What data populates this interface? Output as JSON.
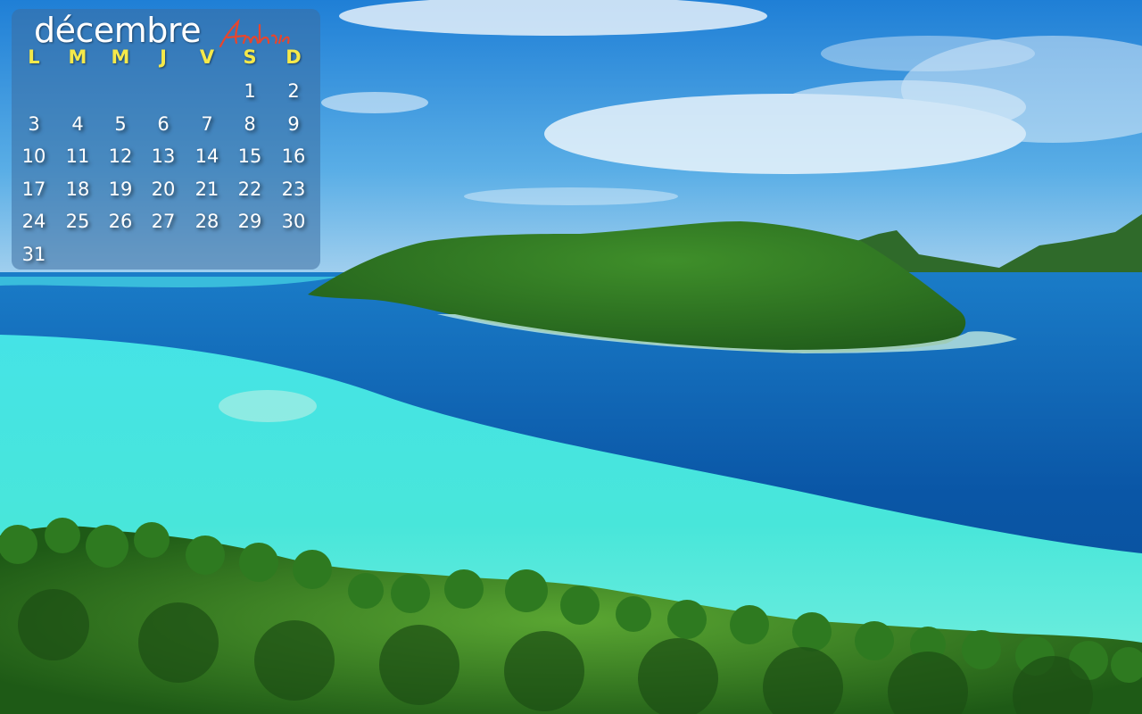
{
  "calendar": {
    "month": "décembre",
    "signature": "Ambre",
    "weekdays": [
      "L",
      "M",
      "M",
      "J",
      "V",
      "S",
      "D"
    ],
    "days": [
      "1",
      "2",
      "3",
      "4",
      "5",
      "6",
      "7",
      "8",
      "9",
      "10",
      "11",
      "12",
      "13",
      "14",
      "15",
      "16",
      "17",
      "18",
      "19",
      "20",
      "21",
      "22",
      "23",
      "24",
      "25",
      "26",
      "27",
      "28",
      "29",
      "30",
      "31"
    ]
  },
  "colors": {
    "weekday": "#f5e94a",
    "day": "#ffffff",
    "signature": "#e8452c",
    "sky": "#2f8fd8",
    "lagoon": "#3fe0d8",
    "deep_water": "#0d5aa8"
  }
}
